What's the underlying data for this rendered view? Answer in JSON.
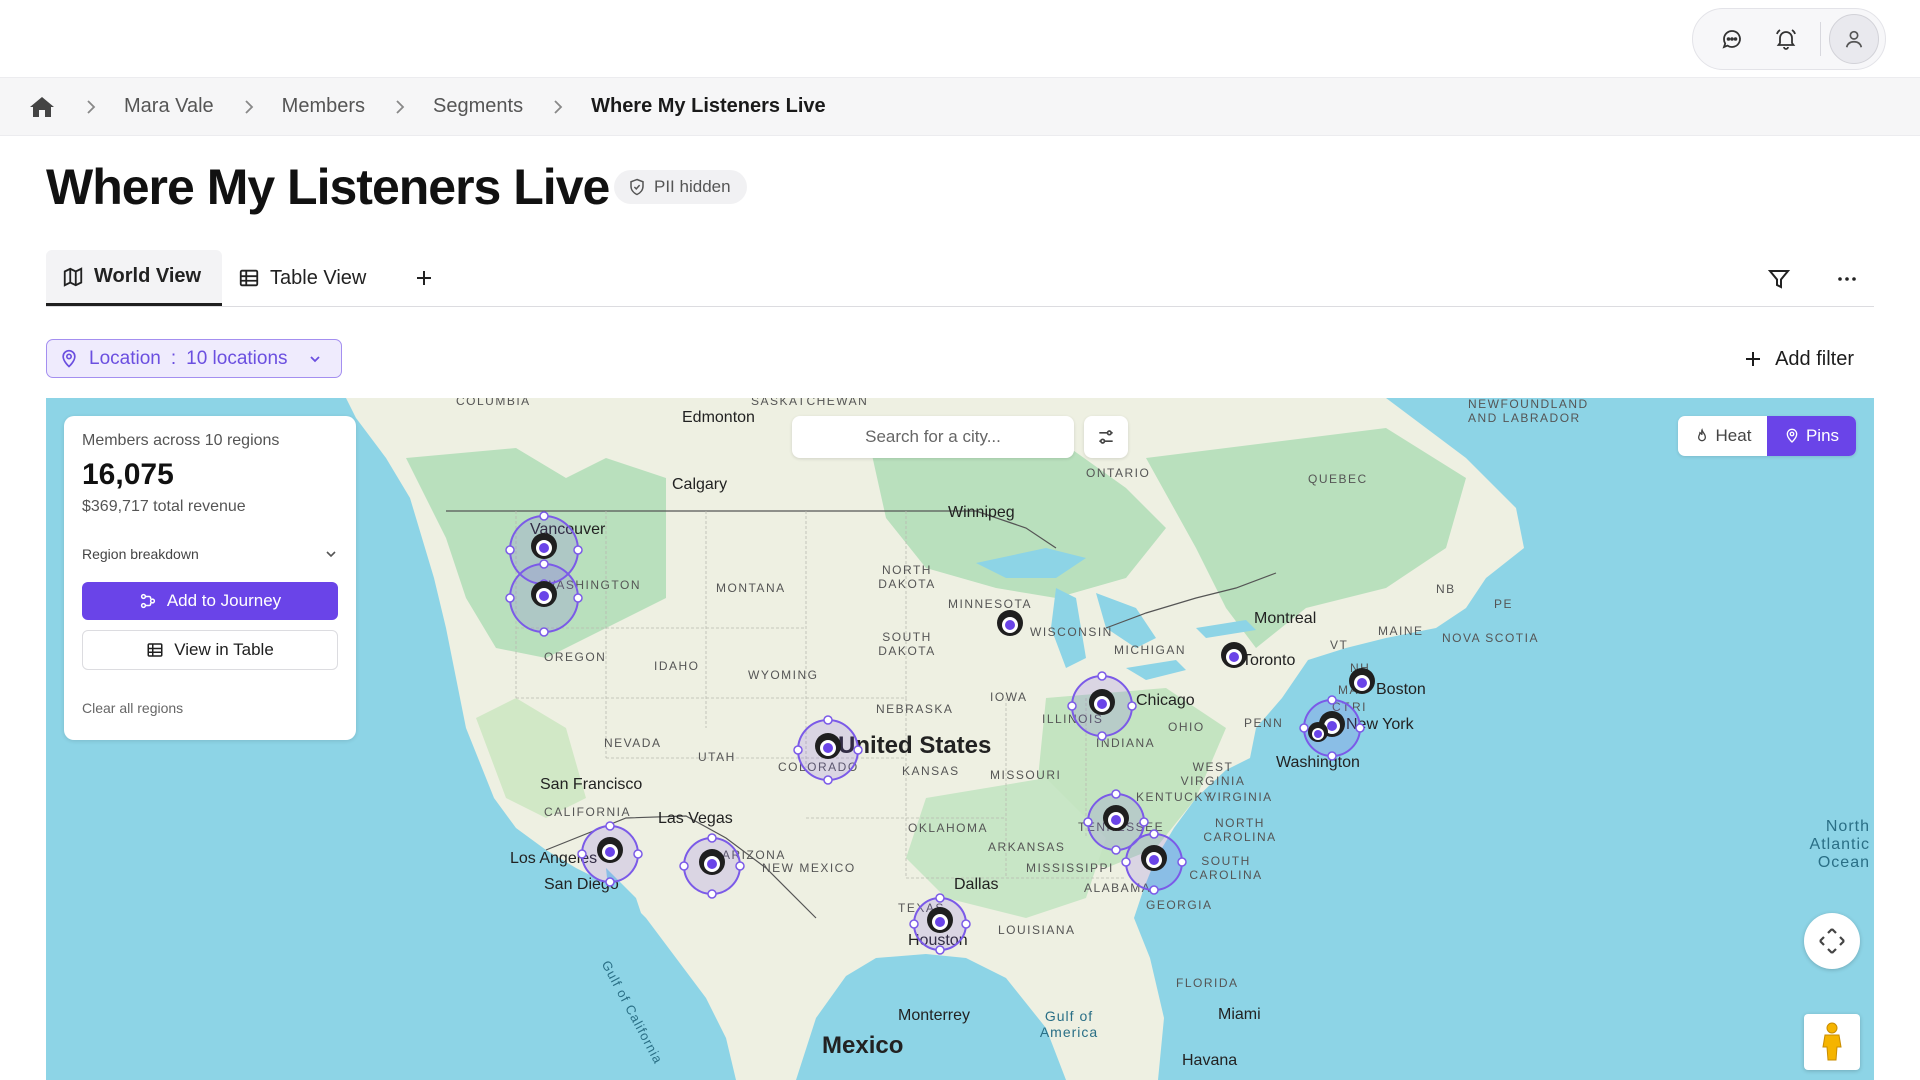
{
  "header": {
    "icons": [
      "chat-icon",
      "bell-icon",
      "user-icon"
    ]
  },
  "breadcrumb": {
    "items": [
      "Mara Vale",
      "Members",
      "Segments",
      "Where My Listeners Live"
    ]
  },
  "page": {
    "title": "Where My Listeners Live",
    "pii_badge": "PII hidden"
  },
  "tabs": {
    "items": [
      {
        "label": "World View",
        "icon": "map-icon",
        "active": true
      },
      {
        "label": "Table View",
        "icon": "table-icon",
        "active": false
      }
    ]
  },
  "filter": {
    "chip_label": "Location",
    "chip_separator": ":",
    "chip_value": "10 locations",
    "add_filter_label": "Add filter"
  },
  "summary": {
    "caption": "Members across 10 regions",
    "count": "16,075",
    "revenue": "$369,717 total revenue",
    "breakdown_label": "Region breakdown",
    "primary_action": "Add to Journey",
    "secondary_action": "View in Table",
    "clear_label": "Clear all regions"
  },
  "map": {
    "search_placeholder": "Search for a city...",
    "modes": [
      {
        "label": "Heat",
        "icon": "flame-icon",
        "active": false
      },
      {
        "label": "Pins",
        "icon": "pin-icon",
        "active": true
      }
    ],
    "accent_color": "#6a44e8",
    "water_color": "#8dd4e6",
    "land_color": "#eef0e2",
    "cities": [
      "Edmonton",
      "Calgary",
      "Winnipeg",
      "Vancouver",
      "Montreal",
      "Toronto",
      "Boston",
      "New York",
      "Washington",
      "Chicago",
      "San Francisco",
      "Las Vegas",
      "Los Angeles",
      "San Diego",
      "Dallas",
      "Houston",
      "Monterrey",
      "Miami",
      "Havana"
    ],
    "regions": [
      "COLUMBIA",
      "SASKATCHEWAN",
      "NEWFOUNDLAND AND LABRADOR",
      "ONTARIO",
      "QUEBEC",
      "WASHINGTON",
      "OREGON",
      "MONTANA",
      "IDAHO",
      "WYOMING",
      "NORTH DAKOTA",
      "SOUTH DAKOTA",
      "MINNESOTA",
      "WISCONSIN",
      "MICHIGAN",
      "NEVADA",
      "UTAH",
      "COLORADO",
      "NEBRASKA",
      "KANSAS",
      "IOWA",
      "ILLINOIS",
      "INDIANA",
      "OHIO",
      "PENN",
      "MISSOURI",
      "WEST VIRGINIA",
      "VIRGINIA",
      "KENTUCKY",
      "TENNESSEE",
      "NORTH CAROLINA",
      "SOUTH CAROLINA",
      "GEORGIA",
      "ALABAMA",
      "MISSISSIPPI",
      "ARKANSAS",
      "OKLAHOMA",
      "TEXAS",
      "LOUISIANA",
      "CALIFORNIA",
      "ARIZONA",
      "NEW MEXICO",
      "FLORIDA",
      "NB",
      "PE",
      "NH",
      "VT",
      "MAINE",
      "NOVA SCOTIA",
      "MA",
      "RI",
      "CT"
    ],
    "countries": [
      "United States",
      "Mexico"
    ],
    "water": [
      "Gulf of America",
      "North Atlantic Ocean",
      "Gulf of California"
    ],
    "selected_regions": 10
  }
}
